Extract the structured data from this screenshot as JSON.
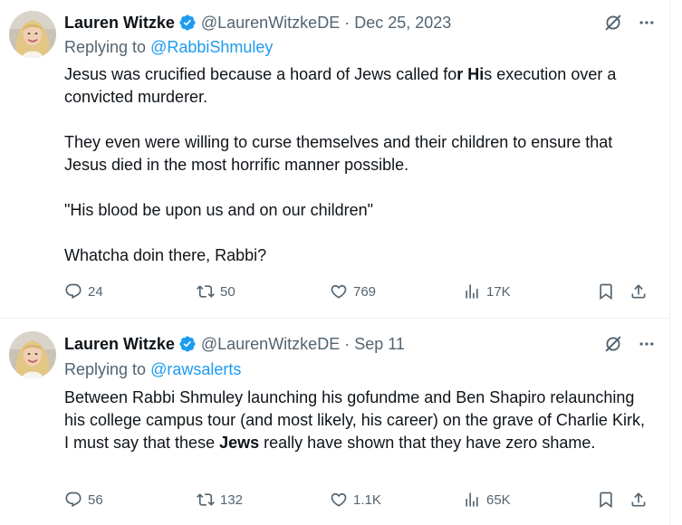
{
  "colors": {
    "text": "#0f1419",
    "secondary": "#536471",
    "link": "#1d9bf0",
    "verified": "#1d9bf0",
    "divider": "#eff3f4"
  },
  "tweets": [
    {
      "author_name": "Lauren Witzke",
      "handle": "@LaurenWitzkeDE",
      "separator": "·",
      "date": "Dec 25, 2023",
      "reply_prefix": "Replying to",
      "reply_to": "@RabbiShmuley",
      "body_p1_a": "Jesus was crucified because a hoard of Jews called fo",
      "body_p1_b1": "r",
      "body_p1_c": " ",
      "body_p1_b2": "Hi",
      "body_p1_d": "s execution over a convicted murderer.",
      "body_p2": "They even were willing to curse themselves and their children to ensure that Jesus died in the most horrific manner possible.",
      "body_p3": "\"His blood be upon us and on our children\"",
      "body_p4": "Whatcha doin there, Rabbi?",
      "replies": "24",
      "retweets": "50",
      "likes": "769",
      "views": "17K",
      "icons": [
        "verified-badge-icon",
        "grok-icon",
        "more-icon",
        "reply-icon",
        "retweet-icon",
        "like-icon",
        "views-icon",
        "bookmark-icon",
        "share-icon"
      ]
    },
    {
      "author_name": "Lauren Witzke",
      "handle": "@LaurenWitzkeDE",
      "separator": "·",
      "date": "Sep 11",
      "reply_prefix": "Replying to",
      "reply_to": "@rawsalerts",
      "body_a": "Between Rabbi Shmuley launching his gofundme and Ben Shapiro relaunching his  college campus tour (and most likely, his career) on the grave of Charlie Kirk, I must say that these ",
      "body_bold": "Jews",
      "body_b": " really have shown that they have zero shame.",
      "replies": "56",
      "retweets": "132",
      "likes": "1.1K",
      "views": "65K",
      "icons": [
        "verified-badge-icon",
        "grok-icon",
        "more-icon",
        "reply-icon",
        "retweet-icon",
        "like-icon",
        "views-icon",
        "bookmark-icon",
        "share-icon"
      ]
    }
  ]
}
